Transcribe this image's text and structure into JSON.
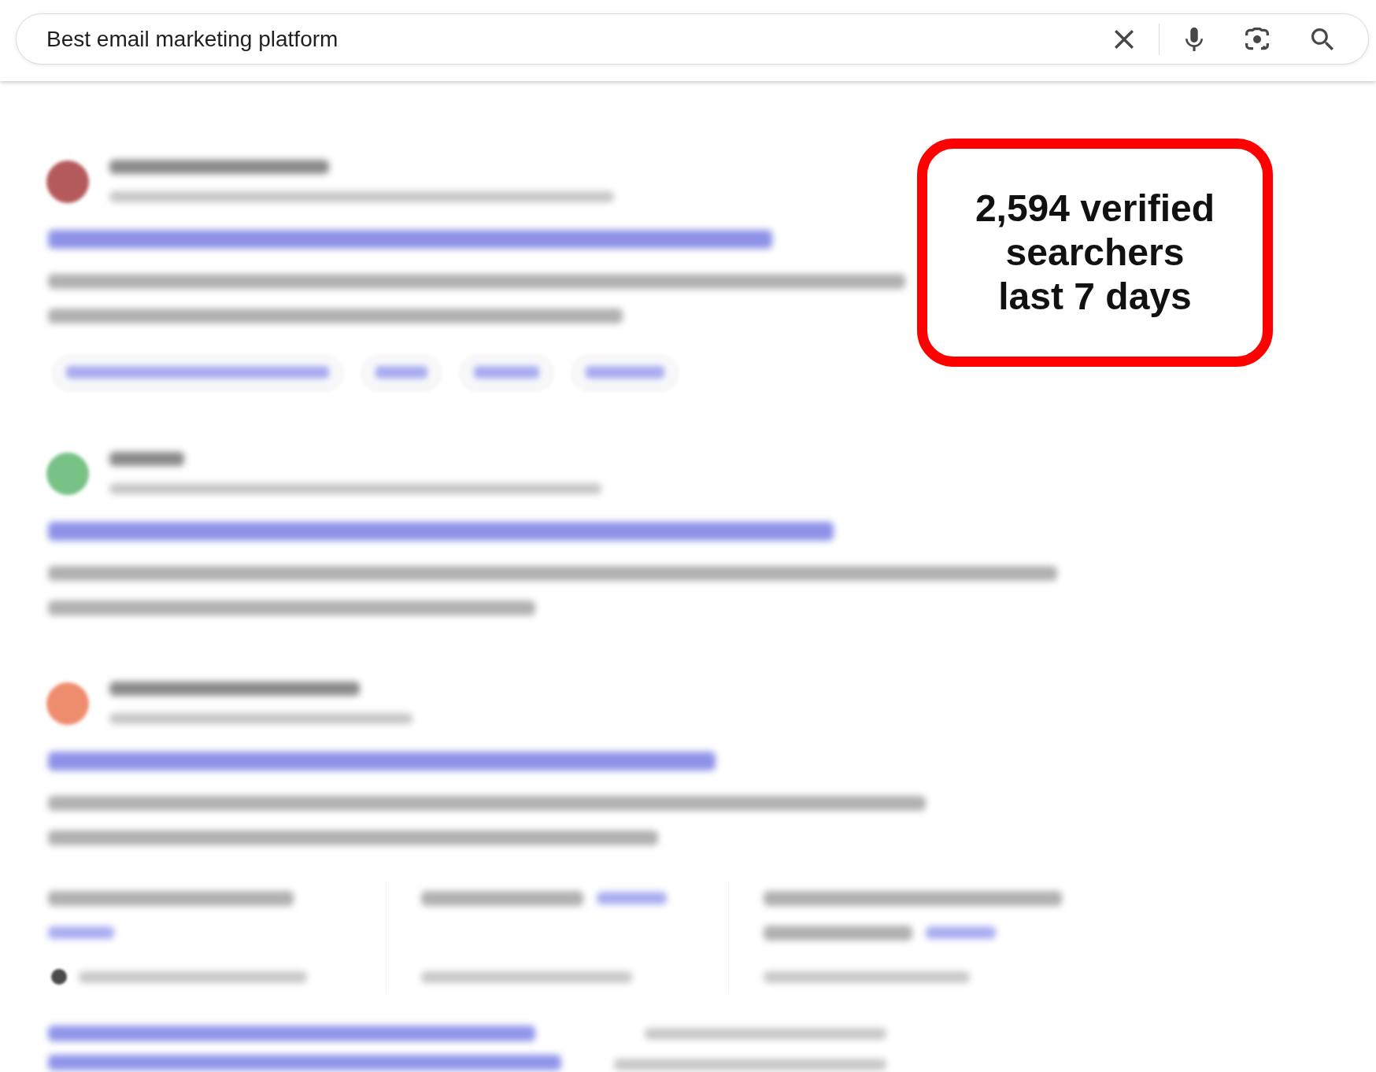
{
  "search_bar": {
    "value": "Best email marketing platform"
  },
  "results": [
    {
      "kind": "sitelinks",
      "color": "#b55a5c"
    },
    {
      "kind": "plain",
      "color": "#78c286"
    },
    {
      "kind": "discussion",
      "color": "#ee8c6e"
    }
  ],
  "callout": {
    "text": "2,594 verified searchers last 7 days"
  }
}
